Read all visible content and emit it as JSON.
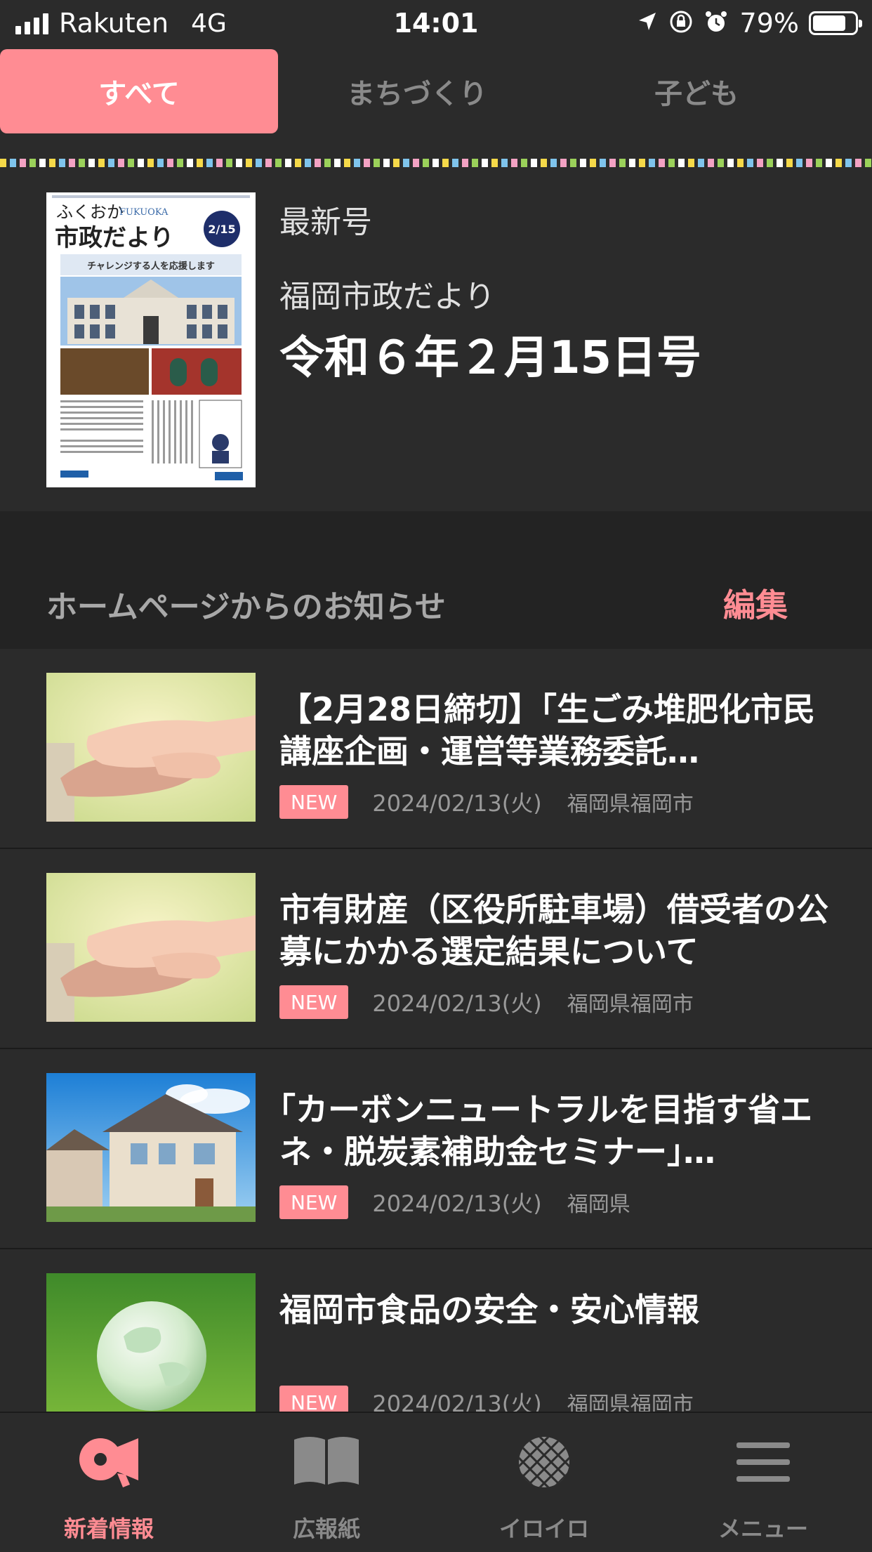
{
  "status_bar": {
    "carrier": "Rakuten",
    "network": "4G",
    "time": "14:01",
    "battery": "79%",
    "battery_level": 0.79
  },
  "tabs": [
    {
      "label": "すべて",
      "active": true
    },
    {
      "label": "まちづくり",
      "active": false
    },
    {
      "label": "子ども",
      "active": false
    }
  ],
  "latest": {
    "label": "最新号",
    "publication": "福岡市政だより",
    "issue": "令和６年２月15日号",
    "cover": {
      "title_kana": "ふくおか",
      "title_en": "FUKUOKA",
      "title_main": "市政だより",
      "date_badge": "2/15",
      "headline": "チャレンジする人を応援します"
    }
  },
  "section": {
    "title": "ホームページからのお知らせ",
    "edit_label": "編集"
  },
  "news": [
    {
      "title": "【2月28日締切】｢生ごみ堆肥化市民講座企画・運営等業務委託…",
      "badge": "NEW",
      "date": "2024/02/13(火)",
      "source": "福岡県福岡市",
      "thumb": "hands-photo"
    },
    {
      "title": "市有財産（区役所駐車場）借受者の公募にかかる選定結果について",
      "badge": "NEW",
      "date": "2024/02/13(火)",
      "source": "福岡県福岡市",
      "thumb": "hands-photo"
    },
    {
      "title": "｢カーボンニュートラルを目指す省エネ・脱炭素補助金セミナー｣…",
      "badge": "NEW",
      "date": "2024/02/13(火)",
      "source": "福岡県",
      "thumb": "house-photo"
    },
    {
      "title": "福岡市食品の安全・安心情報",
      "badge": "NEW",
      "date": "2024/02/13(火)",
      "source": "福岡県福岡市",
      "thumb": "globe-photo"
    }
  ],
  "bottom_nav": [
    {
      "label": "新着情報",
      "icon": "megaphone-icon",
      "active": true
    },
    {
      "label": "広報紙",
      "icon": "book-icon",
      "active": false
    },
    {
      "label": "イロイロ",
      "icon": "grid-ball-icon",
      "active": false
    },
    {
      "label": "メニュー",
      "icon": "menu-icon",
      "active": false
    }
  ],
  "colors": {
    "accent": "#ff8c93",
    "background": "#2b2b2b",
    "band": "#232323"
  }
}
